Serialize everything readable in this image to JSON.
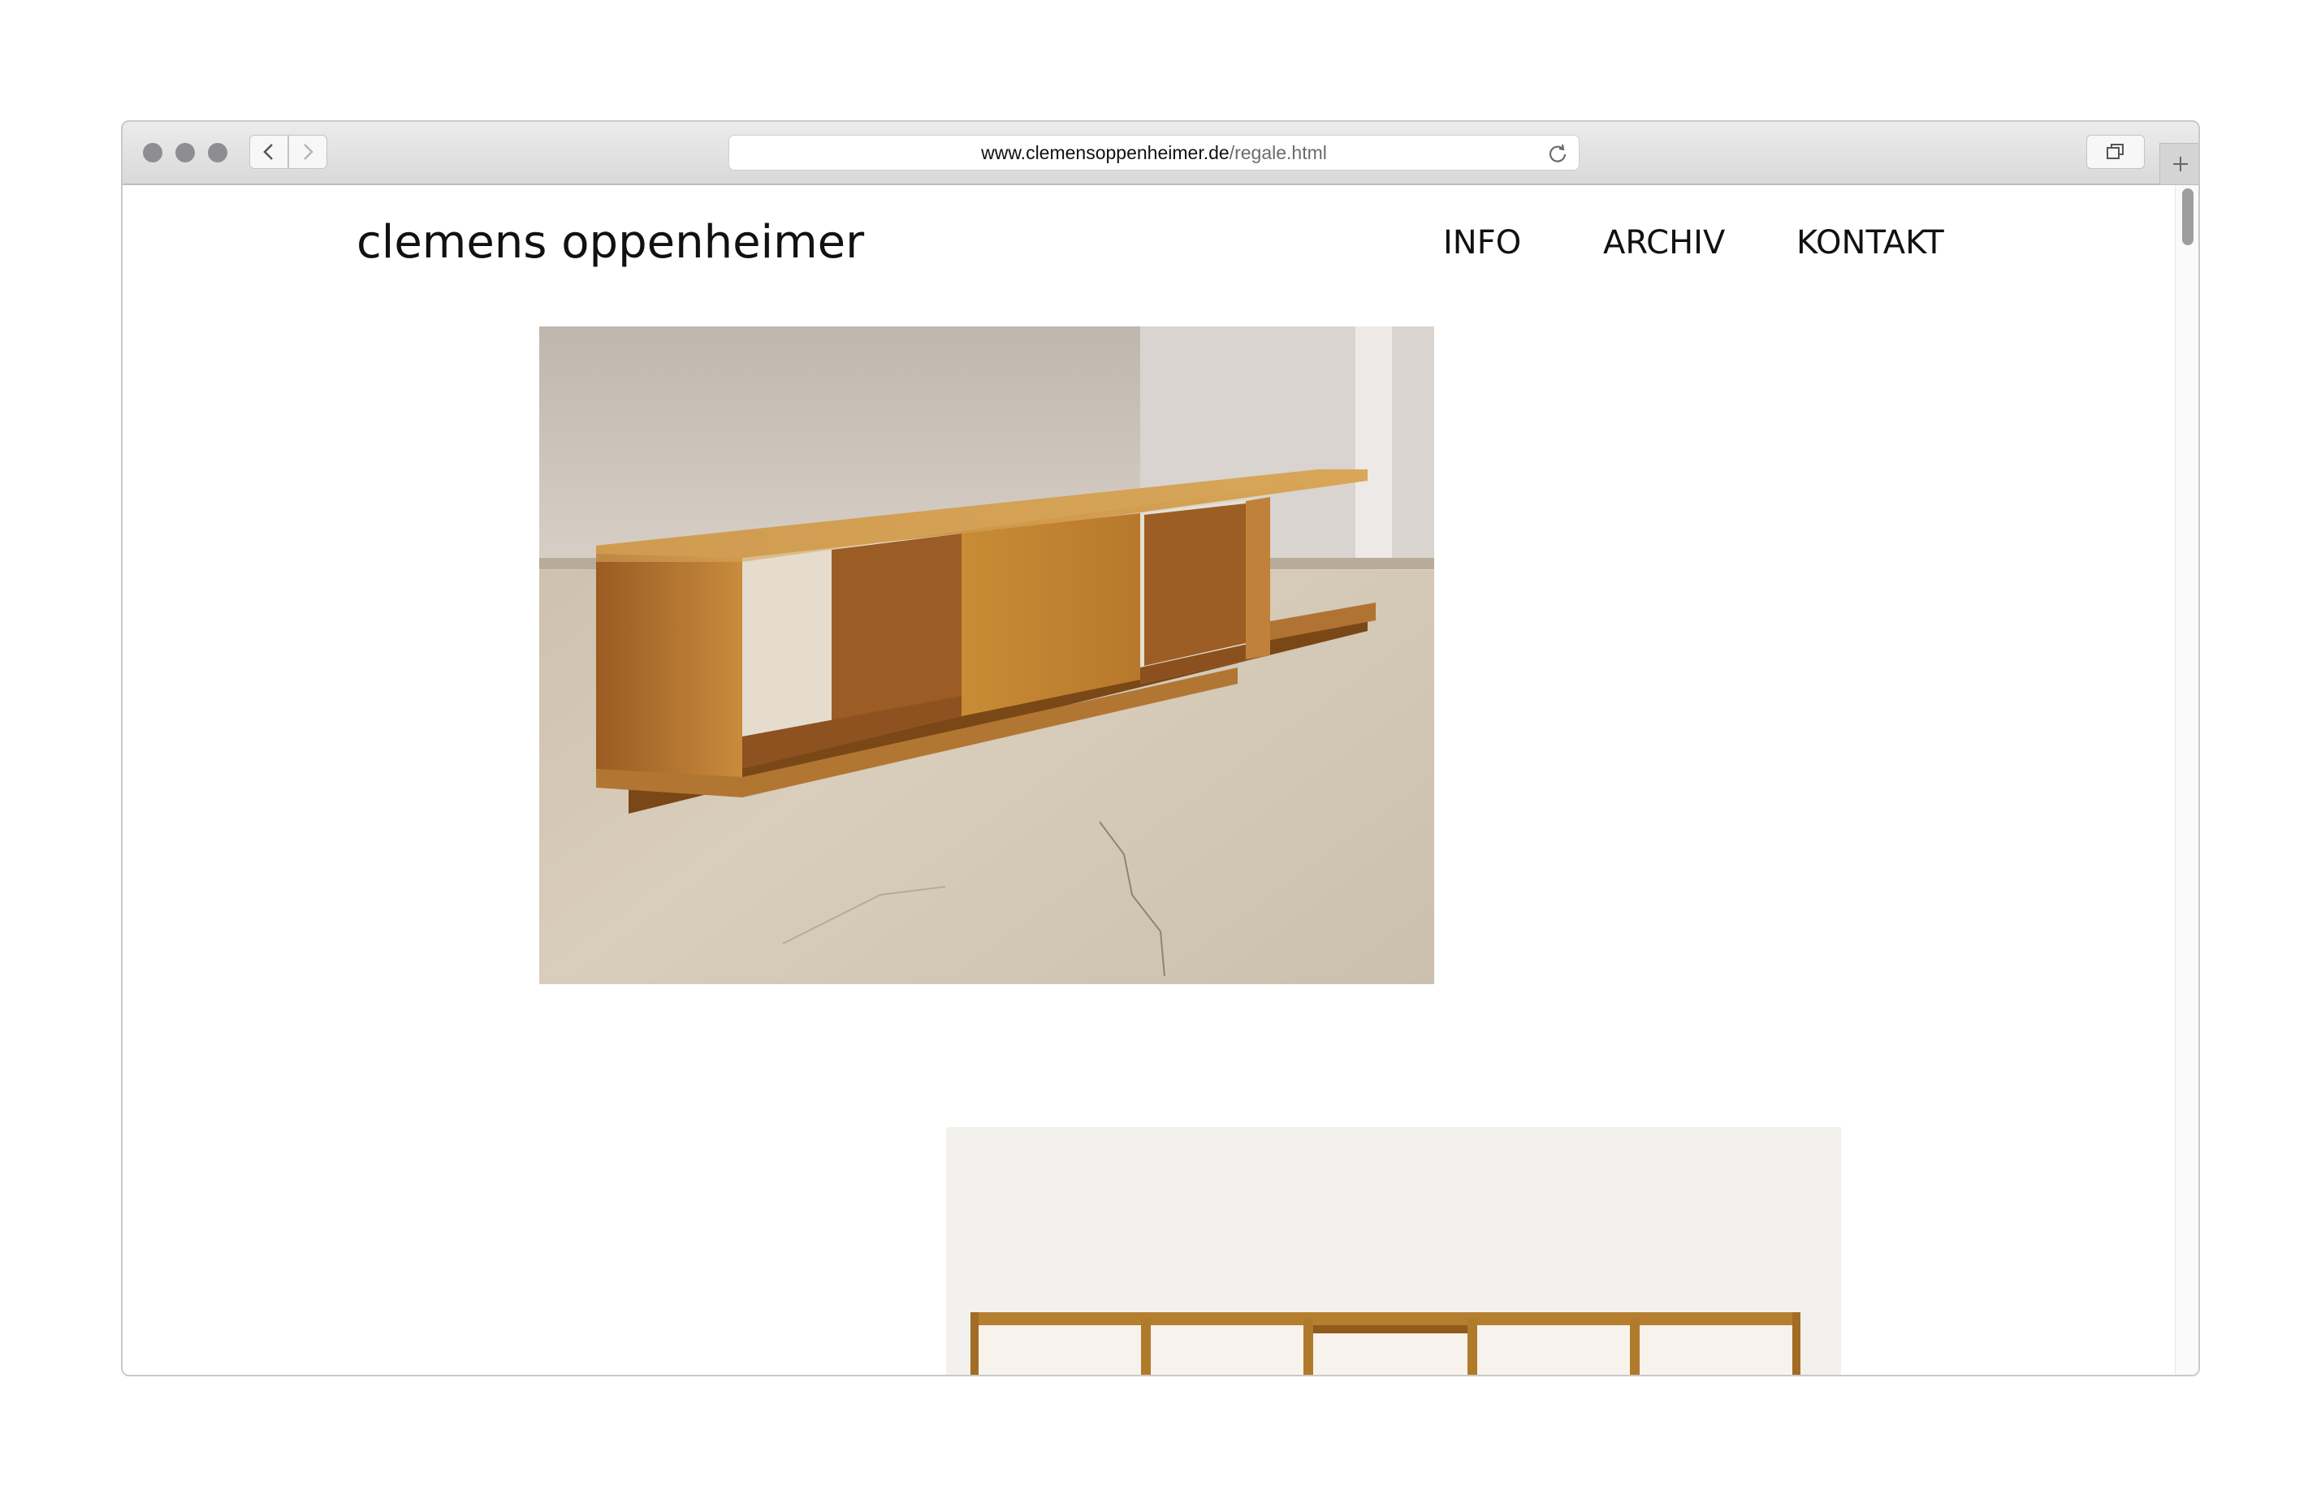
{
  "browser": {
    "url_host": "www.clemensoppenheimer.de",
    "url_path": "/regale.html"
  },
  "site": {
    "logo": "clemens oppenheimer",
    "nav": [
      {
        "label": "INFO"
      },
      {
        "label": "ARCHIV"
      },
      {
        "label": "KONTAKT"
      }
    ]
  },
  "colors": {
    "text": "#111111",
    "wood": "#b97a2e",
    "floor": "#cfc4b4",
    "wall": "#f2f1ee"
  }
}
